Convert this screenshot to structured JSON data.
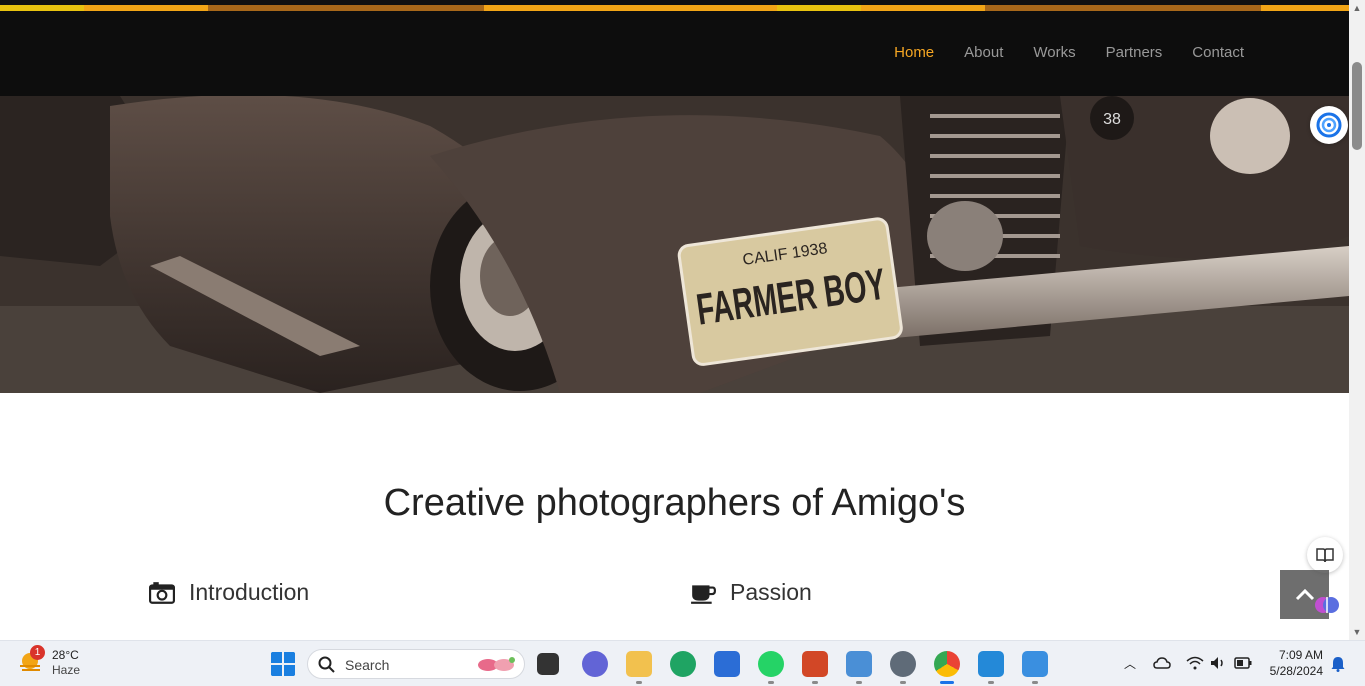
{
  "nav": {
    "items": [
      {
        "label": "Home",
        "active": true
      },
      {
        "label": "About",
        "active": false
      },
      {
        "label": "Works",
        "active": false
      },
      {
        "label": "Partners",
        "active": false
      },
      {
        "label": "Contact",
        "active": false
      }
    ]
  },
  "hero": {
    "plate_top": "CALIF 1938",
    "plate_main": "FARMER BOY",
    "badge_number": "38"
  },
  "main": {
    "title": "Creative photographers of Amigo's",
    "sections": [
      {
        "heading": "Introduction",
        "icon": "camera-icon"
      },
      {
        "heading": "Passion",
        "icon": "coffee-cup-icon"
      }
    ]
  },
  "taskbar": {
    "weather_temp": "28°C",
    "weather_condition": "Haze",
    "weather_badge": "1",
    "search_label": "Search",
    "time": "7:09 AM",
    "date": "5/28/2024"
  },
  "colors": {
    "accent": "#f5a623",
    "nav_bg": "#0d0d0d"
  }
}
